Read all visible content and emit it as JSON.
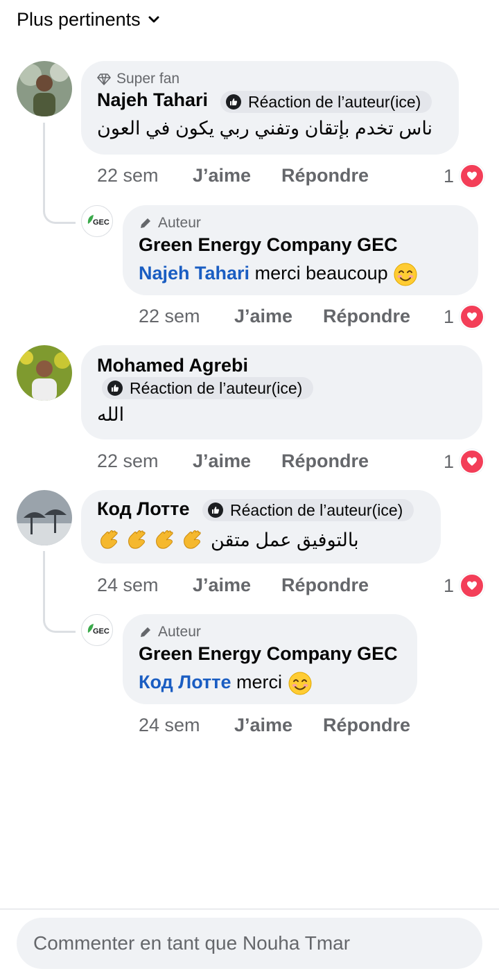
{
  "sort": {
    "label": "Plus pertinents"
  },
  "comments": [
    {
      "badge": "Super fan",
      "name": "Najeh Tahari",
      "reaction_label": "Réaction de l’auteur(ice)",
      "text": "ناس تخدم بإتقان وتفني ربي يكون في العون",
      "time": "22 sem",
      "like_label": "J’aime",
      "reply_label": "Répondre",
      "like_count": "1"
    },
    {
      "badge": "Auteur",
      "name": "Green Energy Company GEC",
      "logo_text": "GEC",
      "mention": "Najeh Tahari",
      "text": "merci beaucoup",
      "time": "22 sem",
      "like_label": "J’aime",
      "reply_label": "Répondre",
      "like_count": "1"
    },
    {
      "name": "Mohamed Agrebi",
      "reaction_label": "Réaction de l’auteur(ice)",
      "text": "الله",
      "time": "22 sem",
      "like_label": "J’aime",
      "reply_label": "Répondre",
      "like_count": "1"
    },
    {
      "name": "Код Лотте",
      "reaction_label": "Réaction de l’auteur(ice)",
      "text": "بالتوفيق عمل متقن",
      "time": "24 sem",
      "like_label": "J’aime",
      "reply_label": "Répondre",
      "like_count": "1"
    },
    {
      "badge": "Auteur",
      "name": "Green Energy Company GEC",
      "logo_text": "GEC",
      "mention": "Код Лотте",
      "text": "merci",
      "time": "24 sem",
      "like_label": "J’aime",
      "reply_label": "Répondre"
    }
  ],
  "composer": {
    "placeholder": "Commenter en tant que Nouha Tmar"
  },
  "icons": {
    "sort": "chevron-down-icon",
    "super_fan": "diamond-icon",
    "author": "pencil-icon",
    "author_reaction": "like-icon",
    "reaction": "heart-icon",
    "emoji_smile": "smiling-face-icon",
    "emoji_clap": "clapping-hands-icon"
  },
  "colors": {
    "mention": "#1a5dc2",
    "bubble": "#f0f2f5",
    "heart": "#f33e58",
    "muted_text": "#65676b"
  }
}
